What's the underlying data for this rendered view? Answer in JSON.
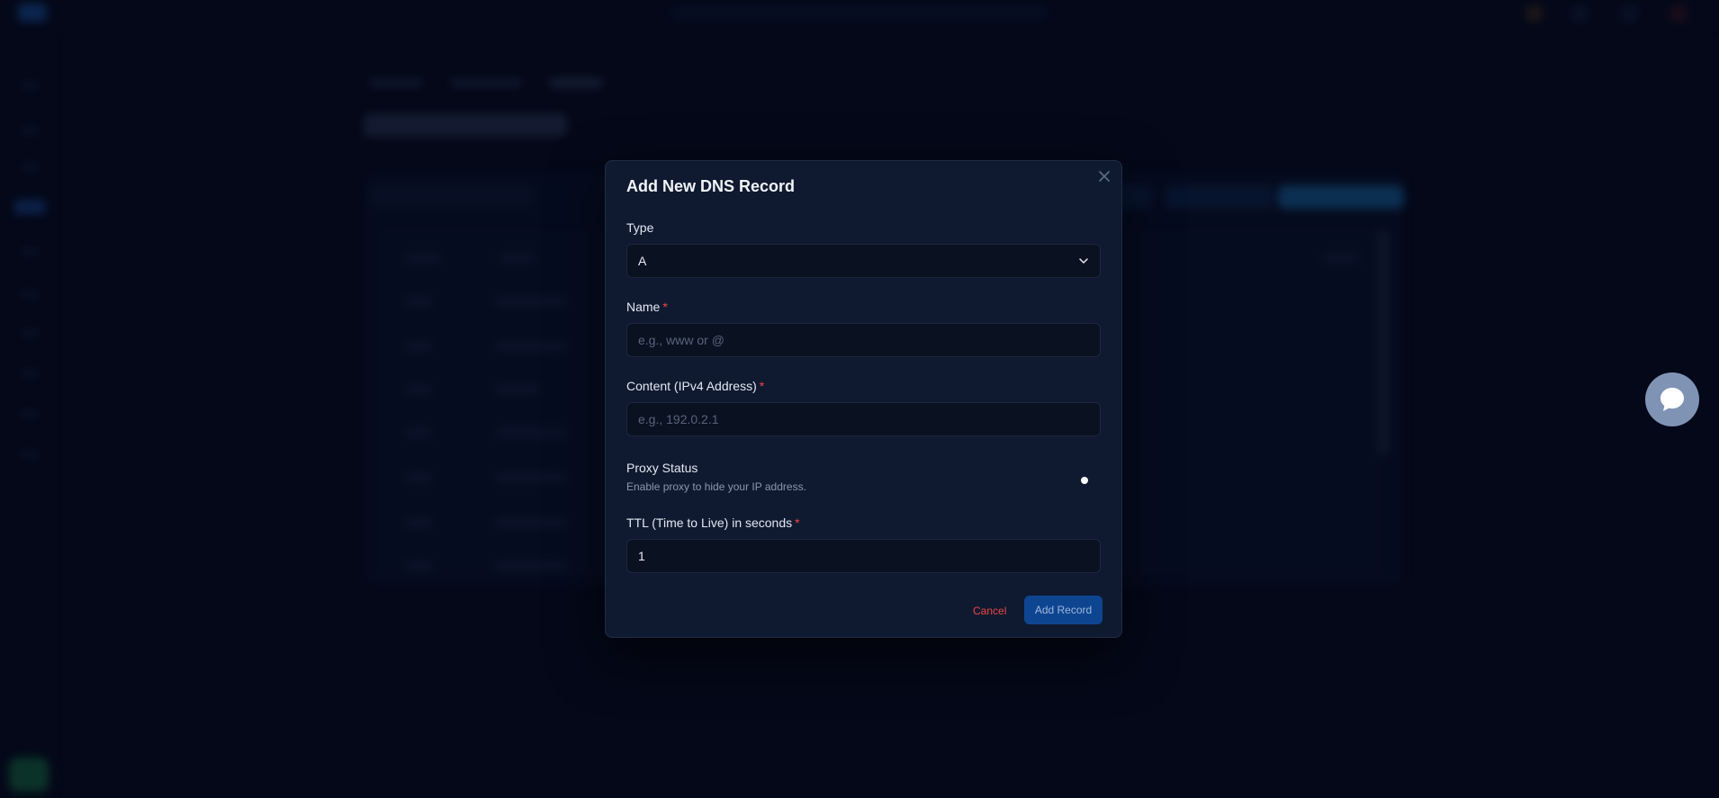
{
  "modal": {
    "title": "Add New DNS Record",
    "close_icon": "close-icon",
    "type_label": "Type",
    "type_value": "A",
    "name_label": "Name",
    "name_placeholder": "e.g., www or @",
    "name_value": "",
    "content_label": "Content (IPv4 Address)",
    "content_placeholder": "e.g., 192.0.2.1",
    "content_value": "",
    "proxy_title": "Proxy Status",
    "proxy_description": "Enable proxy to hide your IP address.",
    "proxy_enabled": false,
    "ttl_label": "TTL (Time to Live) in seconds",
    "ttl_value": "1",
    "required_marker": "*",
    "cancel_label": "Cancel",
    "submit_label": "Add Record"
  },
  "colors": {
    "accent": "#0e4591",
    "danger": "#ef4444",
    "background": "#050a1c",
    "modal_bg": "#0f1a30"
  },
  "chat": {
    "icon": "chat-bubble-icon"
  }
}
